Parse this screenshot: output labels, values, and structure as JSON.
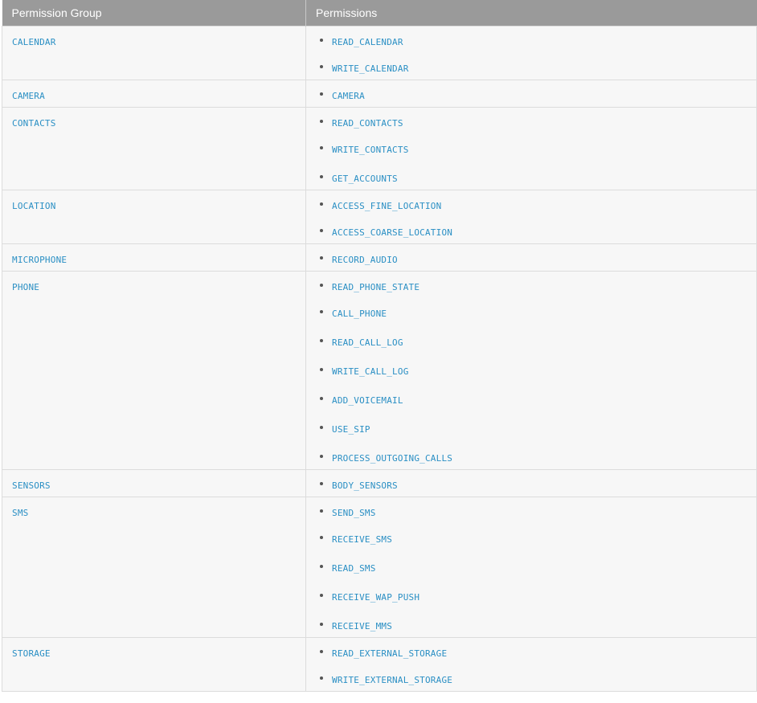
{
  "table": {
    "headers": {
      "group": "Permission Group",
      "permissions": "Permissions"
    },
    "rows": [
      {
        "group": "CALENDAR",
        "permissions": [
          "READ_CALENDAR",
          "WRITE_CALENDAR"
        ]
      },
      {
        "group": "CAMERA",
        "permissions": [
          "CAMERA"
        ]
      },
      {
        "group": "CONTACTS",
        "permissions": [
          "READ_CONTACTS",
          "WRITE_CONTACTS",
          "GET_ACCOUNTS"
        ]
      },
      {
        "group": "LOCATION",
        "permissions": [
          "ACCESS_FINE_LOCATION",
          "ACCESS_COARSE_LOCATION"
        ]
      },
      {
        "group": "MICROPHONE",
        "permissions": [
          "RECORD_AUDIO"
        ]
      },
      {
        "group": "PHONE",
        "permissions": [
          "READ_PHONE_STATE",
          "CALL_PHONE",
          "READ_CALL_LOG",
          "WRITE_CALL_LOG",
          "ADD_VOICEMAIL",
          "USE_SIP",
          "PROCESS_OUTGOING_CALLS"
        ]
      },
      {
        "group": "SENSORS",
        "permissions": [
          "BODY_SENSORS"
        ]
      },
      {
        "group": "SMS",
        "permissions": [
          "SEND_SMS",
          "RECEIVE_SMS",
          "READ_SMS",
          "RECEIVE_WAP_PUSH",
          "RECEIVE_MMS"
        ]
      },
      {
        "group": "STORAGE",
        "permissions": [
          "READ_EXTERNAL_STORAGE",
          "WRITE_EXTERNAL_STORAGE"
        ]
      }
    ]
  },
  "colors": {
    "header_bg": "#9a9a9a",
    "header_text": "#ffffff",
    "row_bg": "#f7f7f7",
    "border": "#dcdcdc",
    "code_text": "#2a8fc4"
  }
}
